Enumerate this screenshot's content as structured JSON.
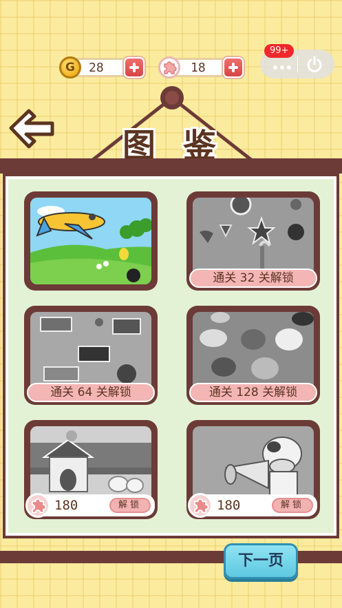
{
  "currency": {
    "coin_icon_letter": "G",
    "coins": "28",
    "pieces": "18"
  },
  "system": {
    "badge": "99+"
  },
  "title": {
    "char1": "图",
    "char2": "鉴"
  },
  "cards": [
    {
      "id": "landscape",
      "state": "unlocked"
    },
    {
      "id": "candy",
      "state": "locked",
      "requirement": "通关 32 关解锁"
    },
    {
      "id": "cake",
      "state": "locked",
      "requirement": "通关 64 关解锁"
    },
    {
      "id": "cats",
      "state": "locked",
      "requirement": "通关 128 关解锁"
    },
    {
      "id": "birdhouse",
      "state": "purchasable",
      "price": "180",
      "unlock_label": "解锁"
    },
    {
      "id": "cow",
      "state": "purchasable",
      "price": "180",
      "unlock_label": "解锁"
    }
  ],
  "footer": {
    "next_page": "下一页"
  },
  "icons": {
    "back": "arrow-left-icon",
    "coin": "coin-icon",
    "puzzle": "puzzle-piece-icon",
    "plus": "plus-icon",
    "more": "more-dots-icon",
    "power": "power-icon"
  },
  "colors": {
    "background": "#fbeb9e",
    "wood": "#6c3b37",
    "panel": "#e3f2d4",
    "lock_banner": "#f4b5b5",
    "next_button": "#5ec8e0"
  }
}
